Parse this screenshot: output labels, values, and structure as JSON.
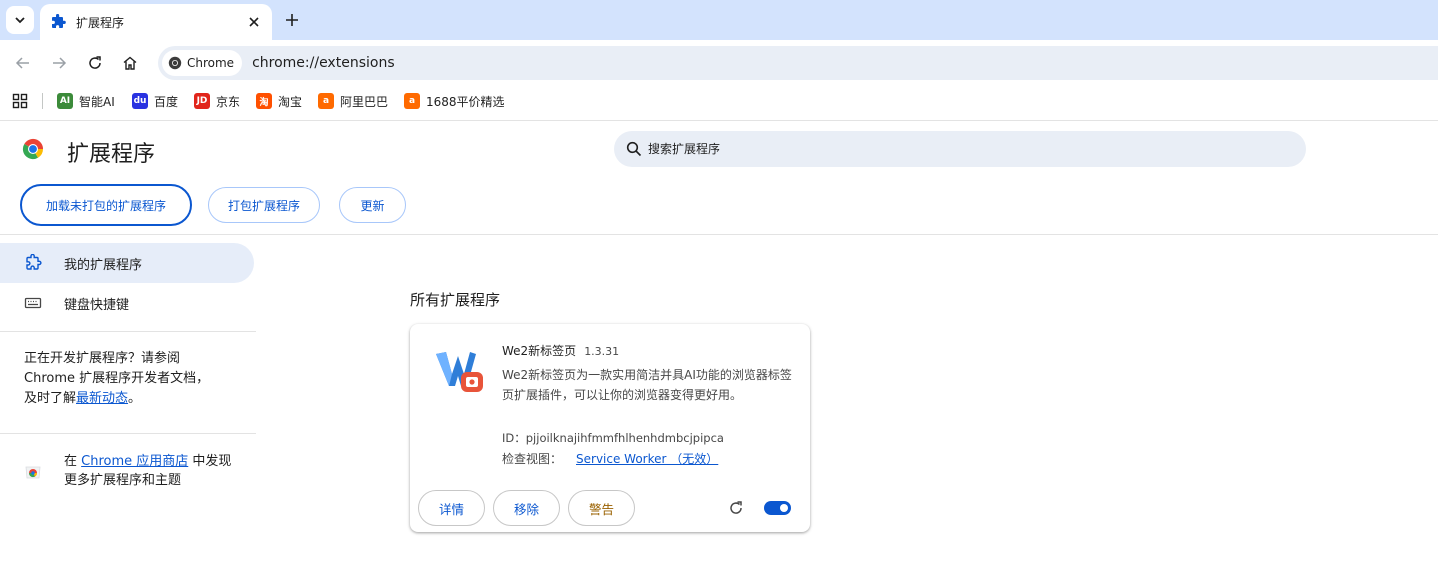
{
  "browser": {
    "tab_title": "扩展程序",
    "omnibox_chip": "Chrome",
    "url": "chrome://extensions"
  },
  "bookmarks": [
    {
      "label": "智能AI",
      "icon": "ai-favicon",
      "color": "#3c8b3a"
    },
    {
      "label": "百度",
      "icon": "baidu-paw-icon",
      "color": "#2932e1"
    },
    {
      "label": "京东",
      "icon": "jd-favicon",
      "color": "#e1251b"
    },
    {
      "label": "淘宝",
      "icon": "taobao-favicon",
      "color": "#ff5000"
    },
    {
      "label": "阿里巴巴",
      "icon": "alibaba-favicon",
      "color": "#ff6a00"
    },
    {
      "label": "1688平价精选",
      "icon": "1688-favicon",
      "color": "#ff6a00"
    }
  ],
  "header": {
    "title": "扩展程序",
    "search_placeholder": "搜索扩展程序"
  },
  "actions": {
    "load_unpacked": "加载未打包的扩展程序",
    "pack": "打包扩展程序",
    "update": "更新"
  },
  "sidebar": {
    "my_extensions": "我的扩展程序",
    "shortcuts": "键盘快捷键",
    "dev_text_1": "正在开发扩展程序？请参阅",
    "dev_text_2": "Chrome 扩展程序开发者文档，",
    "dev_text_3": "及时了解",
    "dev_link": "最新动态",
    "dev_text_4": "。",
    "store_pre": "在 ",
    "store_link": "Chrome 应用商店",
    "store_post": " 中发现更多扩展程序和主题"
  },
  "main": {
    "section_title": "所有扩展程序",
    "extension": {
      "name": "We2新标签页",
      "version": "1.3.31",
      "description": "We2新标签页为一款实用简洁并具AI功能的浏览器标签页扩展插件，可以让你的浏览器变得更好用。",
      "id_label": "ID：",
      "id": "pjjoilknajihfmmfhlhenhdmbcjpipca",
      "inspect_label": "检查视图：",
      "inspect_link": "Service Worker （无效）",
      "details_btn": "详情",
      "remove_btn": "移除",
      "warn_btn": "警告",
      "enabled": true
    }
  },
  "colors": {
    "accent": "#0b57d0",
    "tabstrip": "#d3e3fd",
    "omnibox": "#e9eef6",
    "warning": "#9a6100"
  }
}
